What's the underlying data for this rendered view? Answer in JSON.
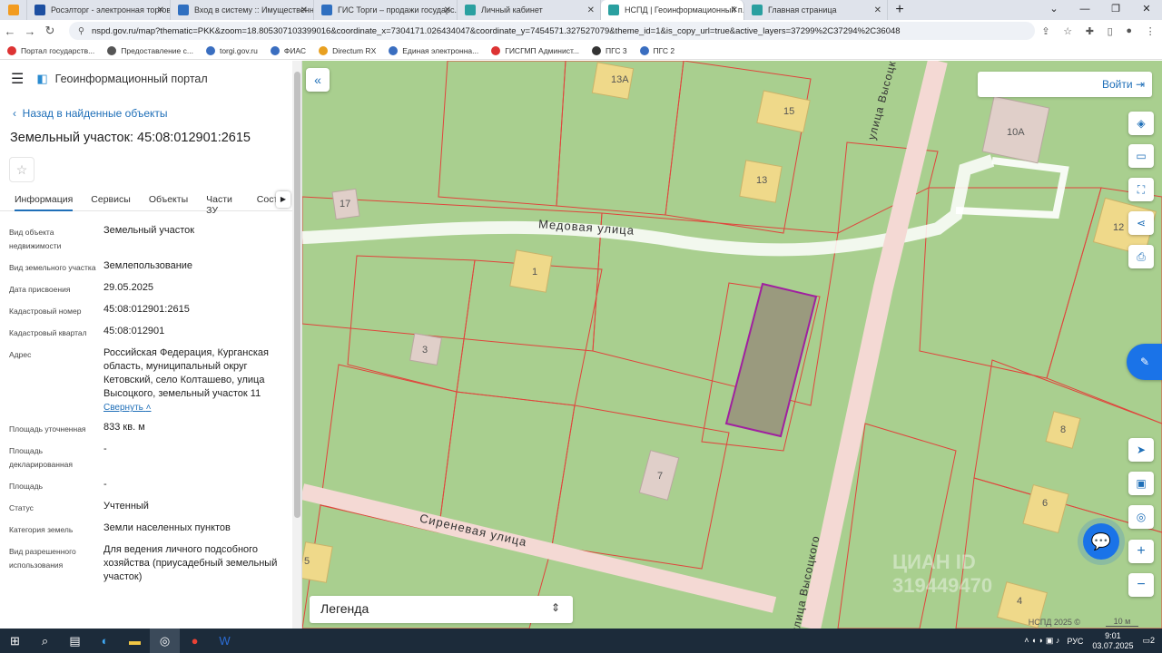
{
  "browser": {
    "tabs": [
      {
        "title": "Росэлторг - электронная торгов...",
        "icon_color": "#1d4fa1"
      },
      {
        "title": "Вход в систему :: Имущественн...",
        "icon_color": "#2f6fc0"
      },
      {
        "title": "ГИС Торги – продажи государс...",
        "icon_color": "#2f6fc0"
      },
      {
        "title": "Личный кабинет",
        "icon_color": "#2aa0a0"
      },
      {
        "title": "НСПД | Геоинформационный п...",
        "icon_color": "#2aa0a0",
        "active": true
      },
      {
        "title": "Главная страница",
        "icon_color": "#2aa0a0"
      }
    ],
    "url": "nspd.gov.ru/map?thematic=PKK&zoom=18.805307103399016&coordinate_x=7304171.026434047&coordinate_y=7454571.327527079&theme_id=1&is_copy_url=true&active_layers=37299%2C37294%2C36048",
    "bookmarks": [
      "Портал государств...",
      "Предоставление с...",
      "torgi.gov.ru",
      "ФИАС",
      "Directum RX",
      "Единая электронна...",
      "ГИСГМП Админист...",
      "ПГС 3",
      "ПГС 2"
    ]
  },
  "panel": {
    "portal_title": "Геоинформационный портал",
    "back_link": "Назад в найденные объекты",
    "object_title": "Земельный участок: 45:08:012901:2615",
    "tabs": [
      "Информация",
      "Сервисы",
      "Объекты",
      "Части ЗУ",
      "Соста"
    ],
    "rows": [
      {
        "label": "Вид объекта недвижимости",
        "value": "Земельный участок"
      },
      {
        "label": "Вид земельного участка",
        "value": "Землепользование"
      },
      {
        "label": "Дата присвоения",
        "value": "29.05.2025"
      },
      {
        "label": "Кадастровый номер",
        "value": "45:08:012901:2615"
      },
      {
        "label": "Кадастровый квартал",
        "value": "45:08:012901"
      },
      {
        "label": "Адрес",
        "value": "Российская Федерация, Курганская область, муниципальный округ Кетовский, село Колташево, улица Высоцкого, земельный участок 11"
      },
      {
        "label": "Площадь уточненная",
        "value": "833 кв. м"
      },
      {
        "label": "Площадь декларированная",
        "value": "-"
      },
      {
        "label": "Площадь",
        "value": "-"
      },
      {
        "label": "Статус",
        "value": "Учтенный"
      },
      {
        "label": "Категория земель",
        "value": "Земли населенных пунктов"
      },
      {
        "label": "Вид разрешенного использования",
        "value": "Для ведения личного подсобного хозяйства (приусадебный земельный участок)"
      }
    ],
    "collapse_link": "Свернуть"
  },
  "map": {
    "login_label": "Войти",
    "legend_label": "Легенда",
    "copyright": "НСПД 2025 ©",
    "scale": "10 м",
    "streets": [
      "Медовая улица",
      "Сиреневая улица",
      "улица Высоцкого",
      "улица Высоцкого"
    ],
    "house_numbers": [
      "13А",
      "15",
      "13",
      "17",
      "1",
      "3",
      "7",
      "10А",
      "12",
      "8",
      "6",
      "4",
      "5"
    ],
    "watermark": "ЦИАН ID 319449470"
  },
  "taskbar": {
    "time": "9:01",
    "date": "03.07.2025",
    "lang": "РУС",
    "notifications": "2"
  }
}
